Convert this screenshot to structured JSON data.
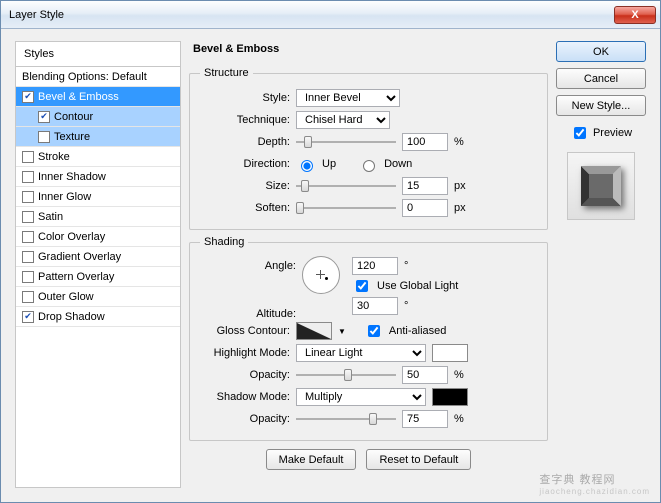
{
  "window": {
    "title": "Layer Style"
  },
  "buttons": {
    "ok": "OK",
    "cancel": "Cancel",
    "newstyle": "New Style...",
    "preview": "Preview",
    "makedefault": "Make Default",
    "reset": "Reset to Default",
    "close": "X"
  },
  "styles": {
    "header": "Styles",
    "blending": "Blending Options: Default",
    "items": [
      {
        "label": "Bevel & Emboss",
        "checked": true,
        "selected": true,
        "indent": false
      },
      {
        "label": "Contour",
        "checked": true,
        "selected": false,
        "subsel": true,
        "indent": true
      },
      {
        "label": "Texture",
        "checked": false,
        "selected": false,
        "subsel": true,
        "indent": true
      },
      {
        "label": "Stroke",
        "checked": false
      },
      {
        "label": "Inner Shadow",
        "checked": false
      },
      {
        "label": "Inner Glow",
        "checked": false
      },
      {
        "label": "Satin",
        "checked": false
      },
      {
        "label": "Color Overlay",
        "checked": false
      },
      {
        "label": "Gradient Overlay",
        "checked": false
      },
      {
        "label": "Pattern Overlay",
        "checked": false
      },
      {
        "label": "Outer Glow",
        "checked": false
      },
      {
        "label": "Drop Shadow",
        "checked": true
      }
    ]
  },
  "panel": {
    "title": "Bevel & Emboss",
    "structure": {
      "legend": "Structure",
      "style_lbl": "Style:",
      "style_val": "Inner Bevel",
      "tech_lbl": "Technique:",
      "tech_val": "Chisel Hard",
      "depth_lbl": "Depth:",
      "depth_val": "100",
      "depth_unit": "%",
      "dir_lbl": "Direction:",
      "dir_up": "Up",
      "dir_down": "Down",
      "size_lbl": "Size:",
      "size_val": "15",
      "size_unit": "px",
      "soften_lbl": "Soften:",
      "soften_val": "0",
      "soften_unit": "px"
    },
    "shading": {
      "legend": "Shading",
      "angle_lbl": "Angle:",
      "angle_val": "120",
      "angle_unit": "°",
      "global": "Use Global Light",
      "alt_lbl": "Altitude:",
      "alt_val": "30",
      "alt_unit": "°",
      "gloss_lbl": "Gloss Contour:",
      "aa": "Anti-aliased",
      "hl_lbl": "Highlight Mode:",
      "hl_val": "Linear Light",
      "op_lbl": "Opacity:",
      "hl_op": "50",
      "op_unit": "%",
      "sh_lbl": "Shadow Mode:",
      "sh_val": "Multiply",
      "sh_op": "75"
    }
  },
  "watermark": {
    "main": "查字典 教程网",
    "sub": "jiaocheng.chazidian.com"
  }
}
